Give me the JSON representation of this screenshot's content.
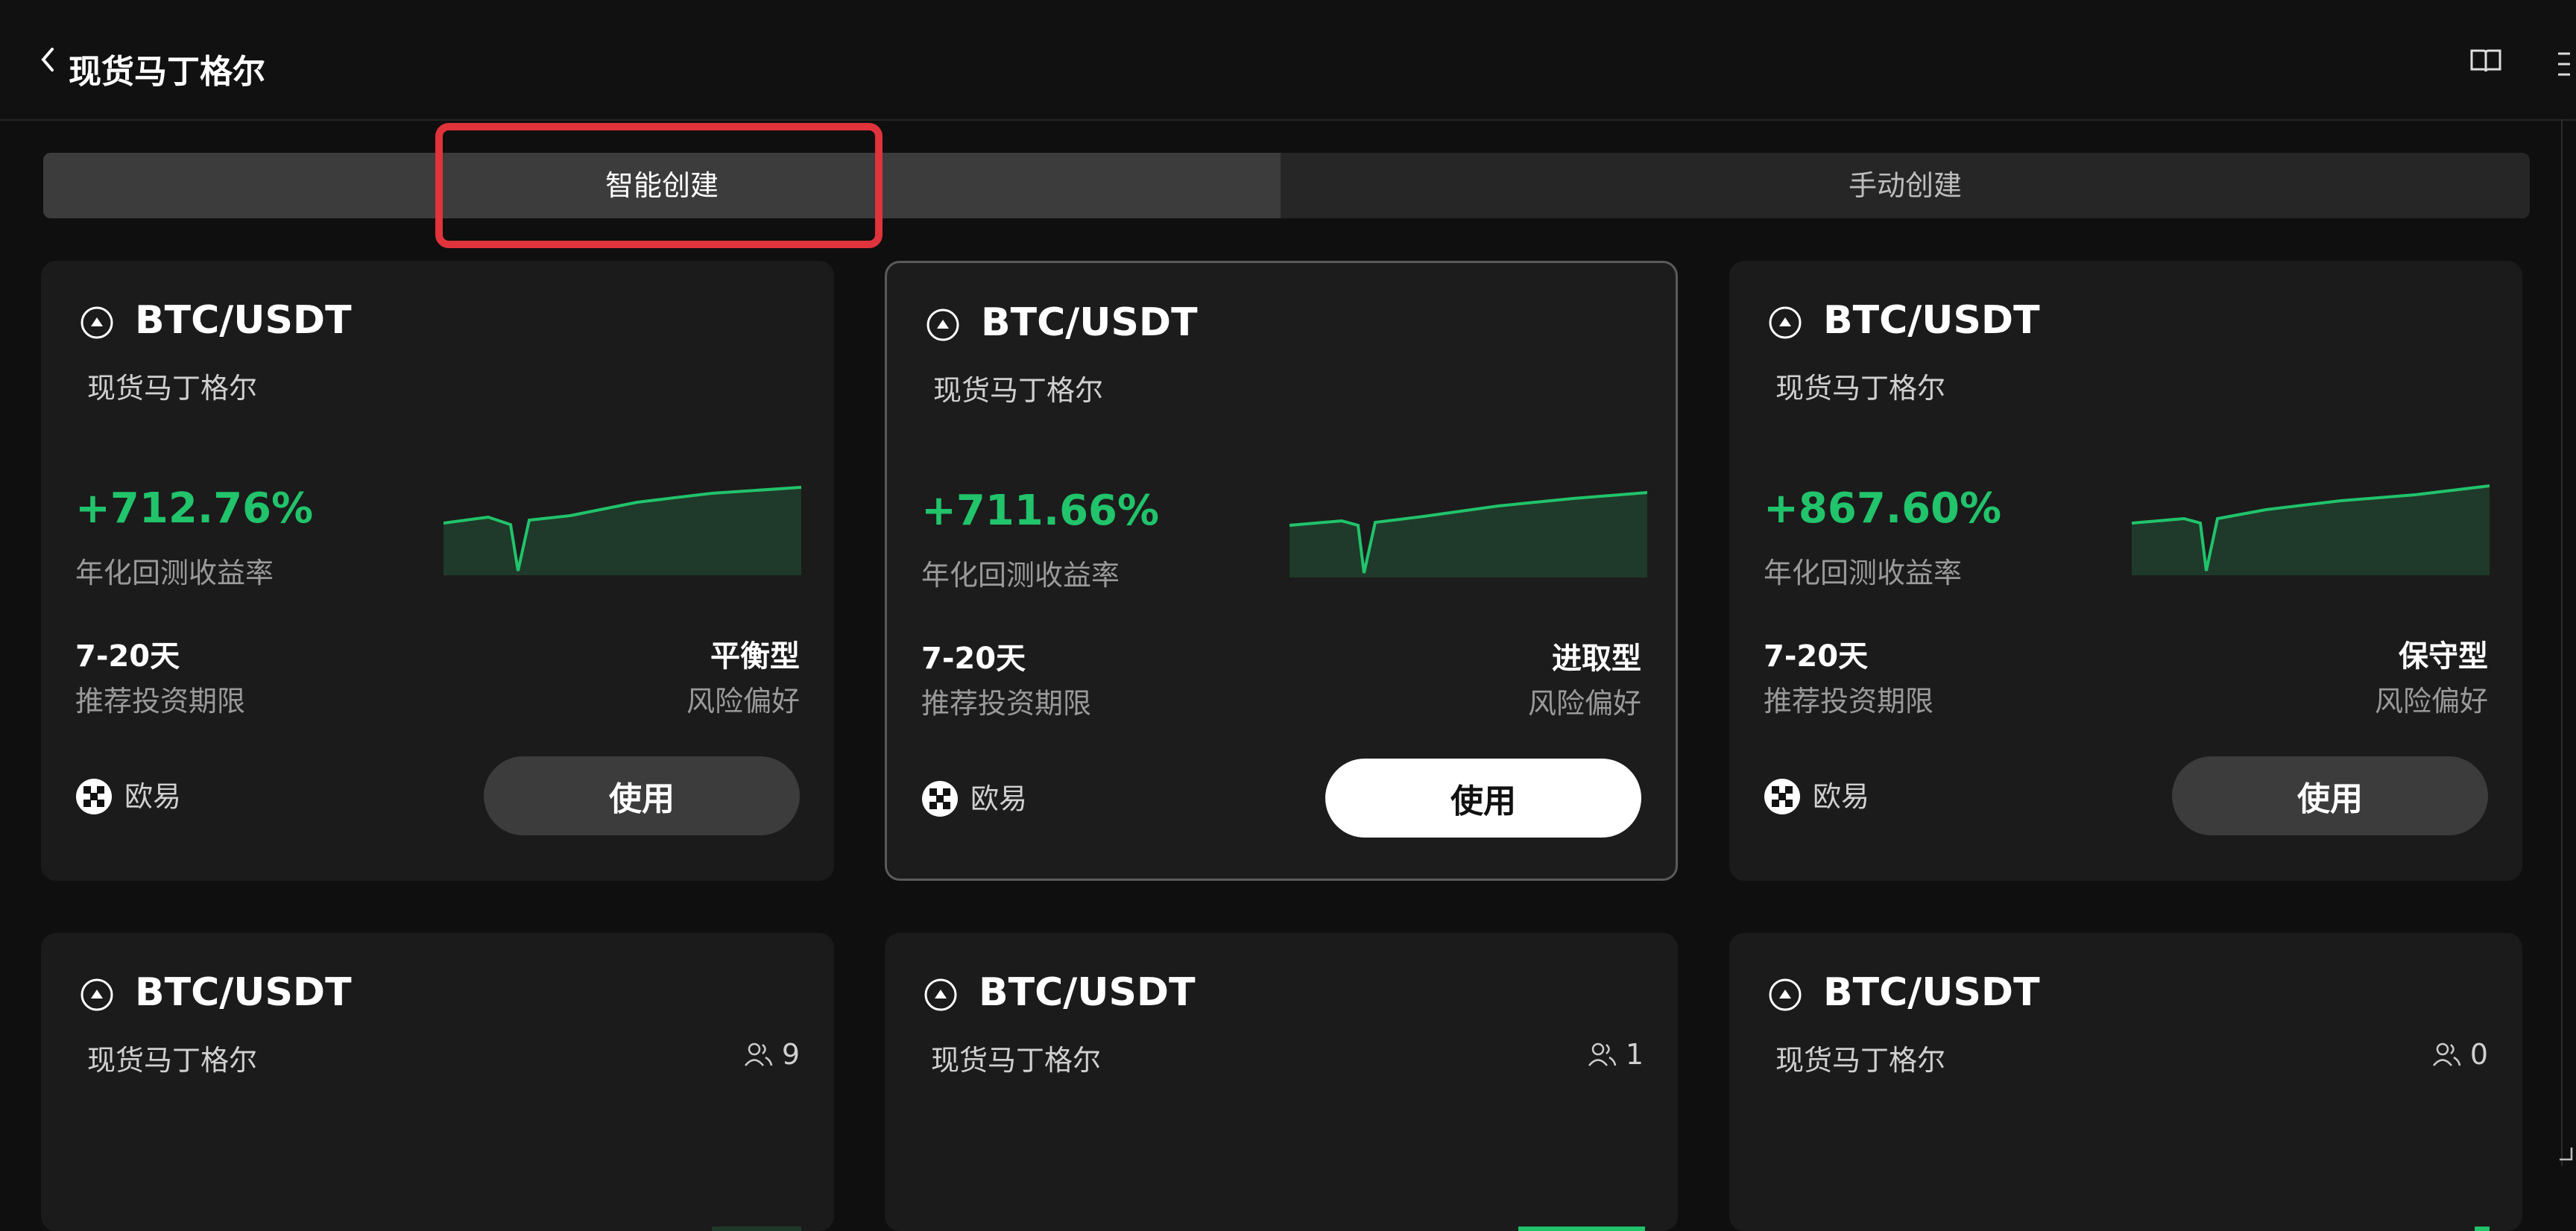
{
  "header": {
    "title": "现货马丁格尔",
    "back_icon": "chevron-left-icon",
    "book_icon": "book-icon",
    "menu_icon": "menu-icon"
  },
  "tabs": [
    {
      "label": "智能创建",
      "active": true
    },
    {
      "label": "手动创建",
      "active": false
    }
  ],
  "colors": {
    "accent_green": "#21c36b",
    "highlight_red": "#e0333c",
    "background": "#0f0f0f",
    "card": "#1b1b1b"
  },
  "cards": [
    {
      "pair": "BTC/USDT",
      "strategy": "现货马丁格尔",
      "return_pct": "+712.76%",
      "return_label": "年化回测收益率",
      "period": "7-20天",
      "period_label": "推荐投资期限",
      "risk": "平衡型",
      "risk_label": "风险偏好",
      "exchange": "欧易",
      "button": "使用",
      "selected": false
    },
    {
      "pair": "BTC/USDT",
      "strategy": "现货马丁格尔",
      "return_pct": "+711.66%",
      "return_label": "年化回测收益率",
      "period": "7-20天",
      "period_label": "推荐投资期限",
      "risk": "进取型",
      "risk_label": "风险偏好",
      "exchange": "欧易",
      "button": "使用",
      "selected": true
    },
    {
      "pair": "BTC/USDT",
      "strategy": "现货马丁格尔",
      "return_pct": "+867.60%",
      "return_label": "年化回测收益率",
      "period": "7-20天",
      "period_label": "推荐投资期限",
      "risk": "保守型",
      "risk_label": "风险偏好",
      "exchange": "欧易",
      "button": "使用",
      "selected": false
    },
    {
      "pair": "BTC/USDT",
      "strategy": "现货马丁格尔",
      "users": "9"
    },
    {
      "pair": "BTC/USDT",
      "strategy": "现货马丁格尔",
      "users": "1"
    },
    {
      "pair": "BTC/USDT",
      "strategy": "现货马丁格尔",
      "users": "0"
    }
  ]
}
